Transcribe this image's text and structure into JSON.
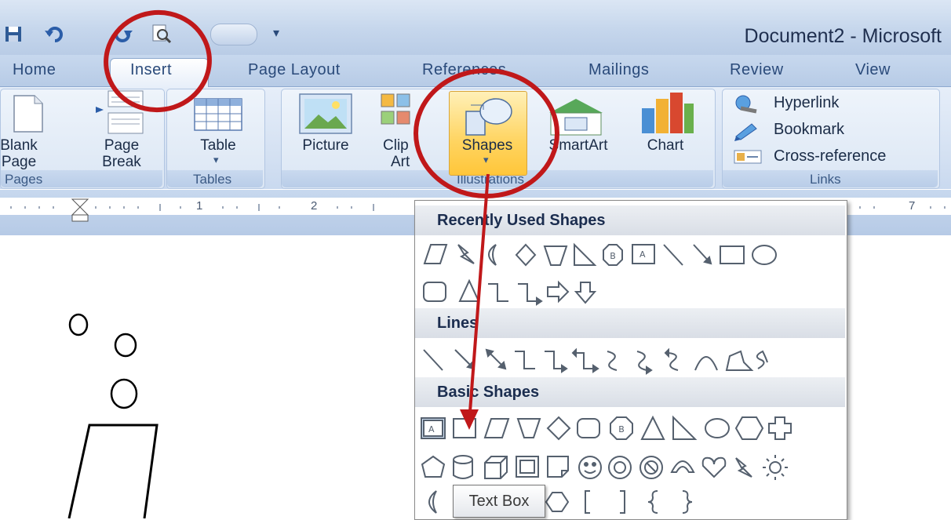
{
  "window": {
    "title": "Document2 - Microsoft "
  },
  "ribbon_tabs": [
    "Home",
    "Insert",
    "Page Layout",
    "References",
    "Mailings",
    "Review",
    "View"
  ],
  "active_tab": "Insert",
  "groups": {
    "pages": {
      "label": "Pages",
      "buttons": {
        "blank_page": [
          "Blank",
          "Page"
        ],
        "page_break": [
          "Page",
          "Break"
        ]
      }
    },
    "tables": {
      "label": "Tables",
      "buttons": {
        "table": "Table"
      }
    },
    "illustrations": {
      "label": "Illustrations",
      "buttons": {
        "picture": "Picture",
        "clip_art": [
          "Clip",
          "Art"
        ],
        "shapes": "Shapes",
        "smartart": "SmartArt",
        "chart": "Chart"
      }
    },
    "links": {
      "label": "Links",
      "items": [
        "Hyperlink",
        "Bookmark",
        "Cross-reference"
      ]
    }
  },
  "ruler": {
    "marks": [
      "1",
      "2",
      "7"
    ]
  },
  "shapes_gallery": {
    "sections": [
      "Recently Used Shapes",
      "Lines",
      "Basic Shapes"
    ]
  },
  "tooltip": "Text Box",
  "icons": [
    "save-icon",
    "undo-icon",
    "redo-icon",
    "print-preview-icon",
    "blank-page-icon",
    "page-break-icon",
    "table-icon",
    "picture-icon",
    "clip-art-icon",
    "shapes-icon",
    "smartart-icon",
    "chart-icon",
    "hyperlink-icon",
    "bookmark-icon",
    "cross-reference-icon"
  ],
  "annotation_color": "#c0181a"
}
